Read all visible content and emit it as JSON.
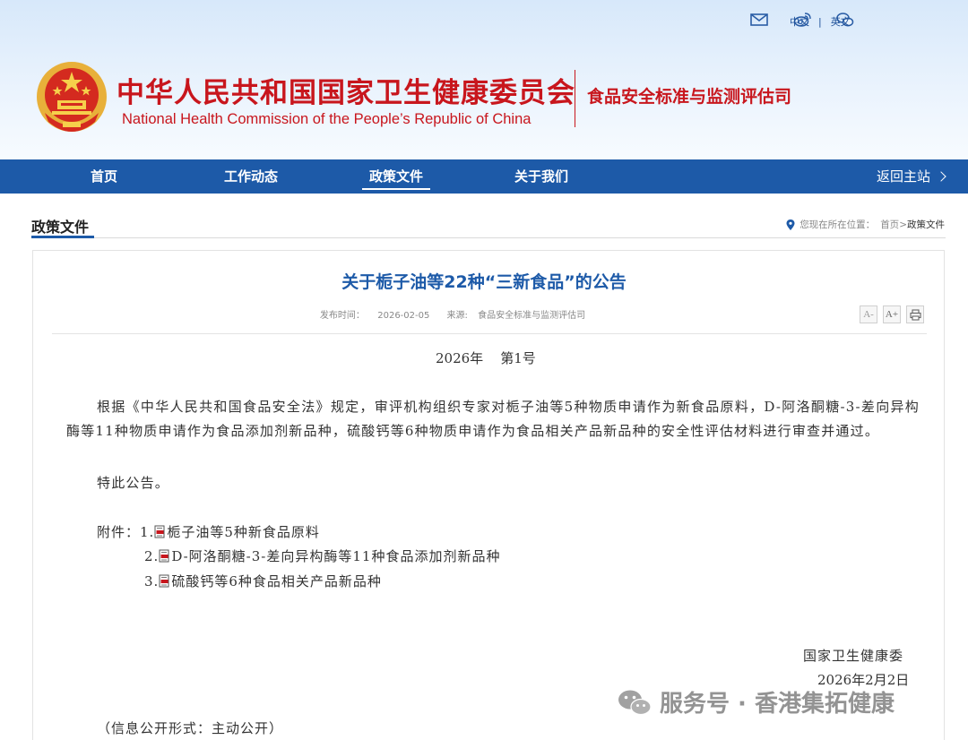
{
  "header": {
    "org_cn": "中华人民共和国国家卫生健康委员会",
    "org_en": "National Health Commission of the People’s Republic of China",
    "dept": "食品安全标准与监测评估司",
    "icons": [
      "mail-icon",
      "weibo-icon",
      "wechat-icon"
    ],
    "lang_cn": "中文",
    "lang_sep": "|",
    "lang_en": "英文"
  },
  "nav": {
    "items": [
      {
        "label": "首页"
      },
      {
        "label": "工作动态"
      },
      {
        "label": "政策文件",
        "active": true
      },
      {
        "label": "关于我们"
      }
    ],
    "back_label": "返回主站"
  },
  "section": {
    "title": "政策文件",
    "breadcrumb": {
      "prefix": "您现在所在位置：",
      "home": "首页",
      "sep": ">",
      "current": "政策文件"
    }
  },
  "article": {
    "title": "关于栀子油等22种“三新食品”的公告",
    "meta": {
      "date_label": "发布时间：",
      "date": "2026-02-05",
      "source_label": "来源:",
      "source": "食品安全标准与监测评估司"
    },
    "tools": {
      "font_small": "A-",
      "font_large": "A+"
    },
    "issue": "2026年    第1号",
    "paragraph": "根据《中华人民共和国食品安全法》规定，审评机构组织专家对栀子油等5种物质申请作为新食品原料，D-阿洛酮糖-3-差向异构酶等11种物质申请作为食品添加剂新品种，硫酸钙等6种物质申请作为食品相关产品新品种的安全性评估材料进行审查并通过。",
    "notice": "特此公告。",
    "attachments_label": "附件：",
    "attachments": [
      {
        "num": "1.",
        "text": "栀子油等5种新食品原料"
      },
      {
        "num": "2.",
        "text": "D-阿洛酮糖-3-差向异构酶等11种食品添加剂新品种"
      },
      {
        "num": "3.",
        "text": "硫酸钙等6种食品相关产品新品种"
      }
    ],
    "signature": "国家卫生健康委",
    "sign_date": "2026年2月2日",
    "disclosure": "（信息公开形式：主动公开）"
  },
  "watermark": {
    "text": "服务号 · 香港集拓健康"
  },
  "colors": {
    "brand_red": "#c8161d",
    "nav_blue": "#1d5aa8"
  }
}
